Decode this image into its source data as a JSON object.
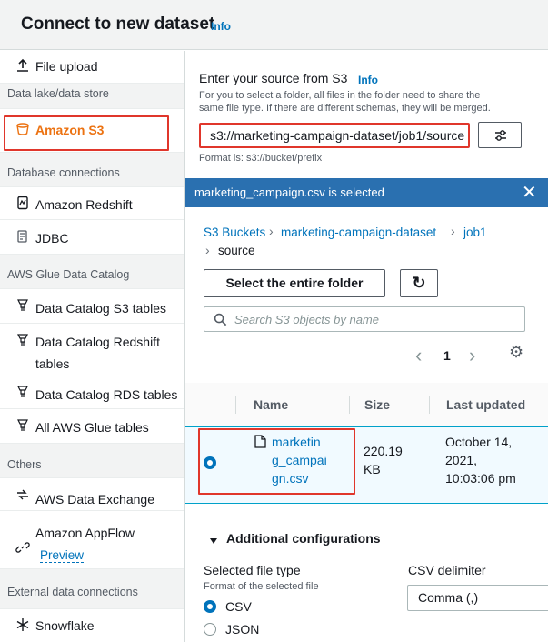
{
  "header": {
    "title": "Connect to new dataset",
    "info": "Info"
  },
  "sidebar": {
    "file_upload": "File upload",
    "section_datalake": "Data lake/data store",
    "amazon_s3": "Amazon S3",
    "section_db": "Database connections",
    "amazon_redshift": "Amazon Redshift",
    "jdbc": "JDBC",
    "section_glue": "AWS Glue Data Catalog",
    "dc_s3": "Data Catalog S3 tables",
    "dc_redshift_1": "Data Catalog Redshift",
    "dc_redshift_2": "tables",
    "dc_rds": "Data Catalog RDS tables",
    "all_glue": "All AWS Glue tables",
    "section_others": "Others",
    "data_exchange": "AWS Data Exchange",
    "appflow": "Amazon AppFlow",
    "appflow_preview": "Preview",
    "section_external": "External data connections",
    "snowflake": "Snowflake"
  },
  "source": {
    "label": "Enter your source from S3",
    "info": "Info",
    "desc_1": "For you to select a folder, all files in the folder need to share the",
    "desc_2": "same file type. If there are different schemas, they will be merged.",
    "uri_value": "s3://marketing-campaign-dataset/job1/source",
    "hint": "Format is: s3://bucket/prefix"
  },
  "selection": {
    "text": "marketing_campaign.csv is selected",
    "close": "✕"
  },
  "breadcrumb": {
    "b1": "S3 Buckets",
    "b2": "marketing-campaign-dataset",
    "b3": "job1",
    "b4": "source"
  },
  "toolbar": {
    "select_folder": "Select the entire folder",
    "refresh": "↻"
  },
  "search": {
    "placeholder": "Search S3 objects by name"
  },
  "pager": {
    "prev": "‹",
    "page": "1",
    "next": "›",
    "settings": "⚙"
  },
  "table": {
    "col_name": "Name",
    "col_size": "Size",
    "col_updated": "Last updated",
    "row": {
      "name_1": "marketin",
      "name_2": "g_campai",
      "name_3": "gn.csv",
      "size_1": "220.19",
      "size_2": "KB",
      "updated_1": "October 14,",
      "updated_2": "2021,",
      "updated_3": "10:03:06 pm"
    }
  },
  "config": {
    "heading": "Additional configurations",
    "file_type_label": "Selected file type",
    "file_type_desc": "Format of the selected file",
    "opt_csv": "CSV",
    "opt_json": "JSON",
    "delimiter_label": "CSV delimiter",
    "delimiter_value": "Comma (,)"
  },
  "colors": {
    "accent": "#0073bb",
    "selected": "#ec7211",
    "highlight": "#e0362b",
    "banner": "#2a70b0"
  }
}
